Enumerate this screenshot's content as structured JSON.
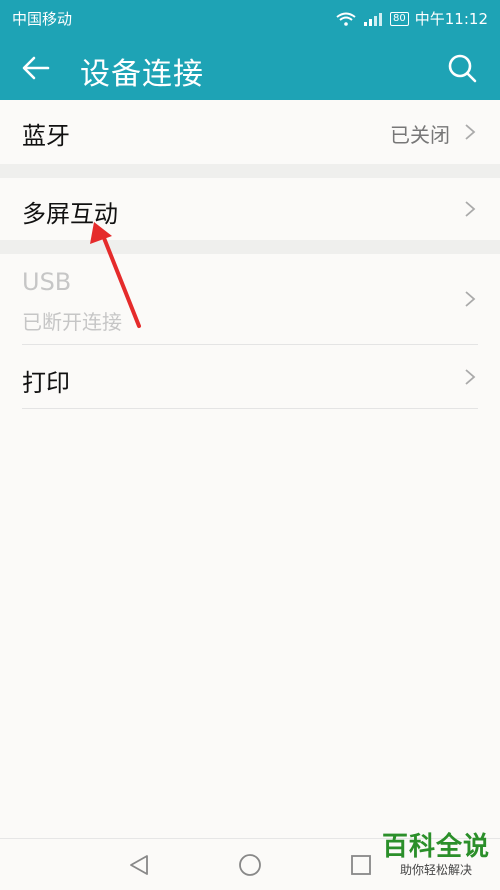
{
  "status_bar": {
    "carrier": "中国移动",
    "battery": "80",
    "time": "中午11:12"
  },
  "app_bar": {
    "title": "设备连接"
  },
  "items": [
    {
      "label": "蓝牙",
      "value": "已关闭"
    },
    {
      "label": "多屏互动"
    },
    {
      "label": "USB",
      "subtitle": "已断开连接"
    },
    {
      "label": "打印"
    }
  ],
  "watermark": {
    "title": "百科全说",
    "subtitle": "助你轻松解决"
  },
  "colors": {
    "accent": "#1ea3b5",
    "annotation_arrow": "#e52b2b"
  }
}
